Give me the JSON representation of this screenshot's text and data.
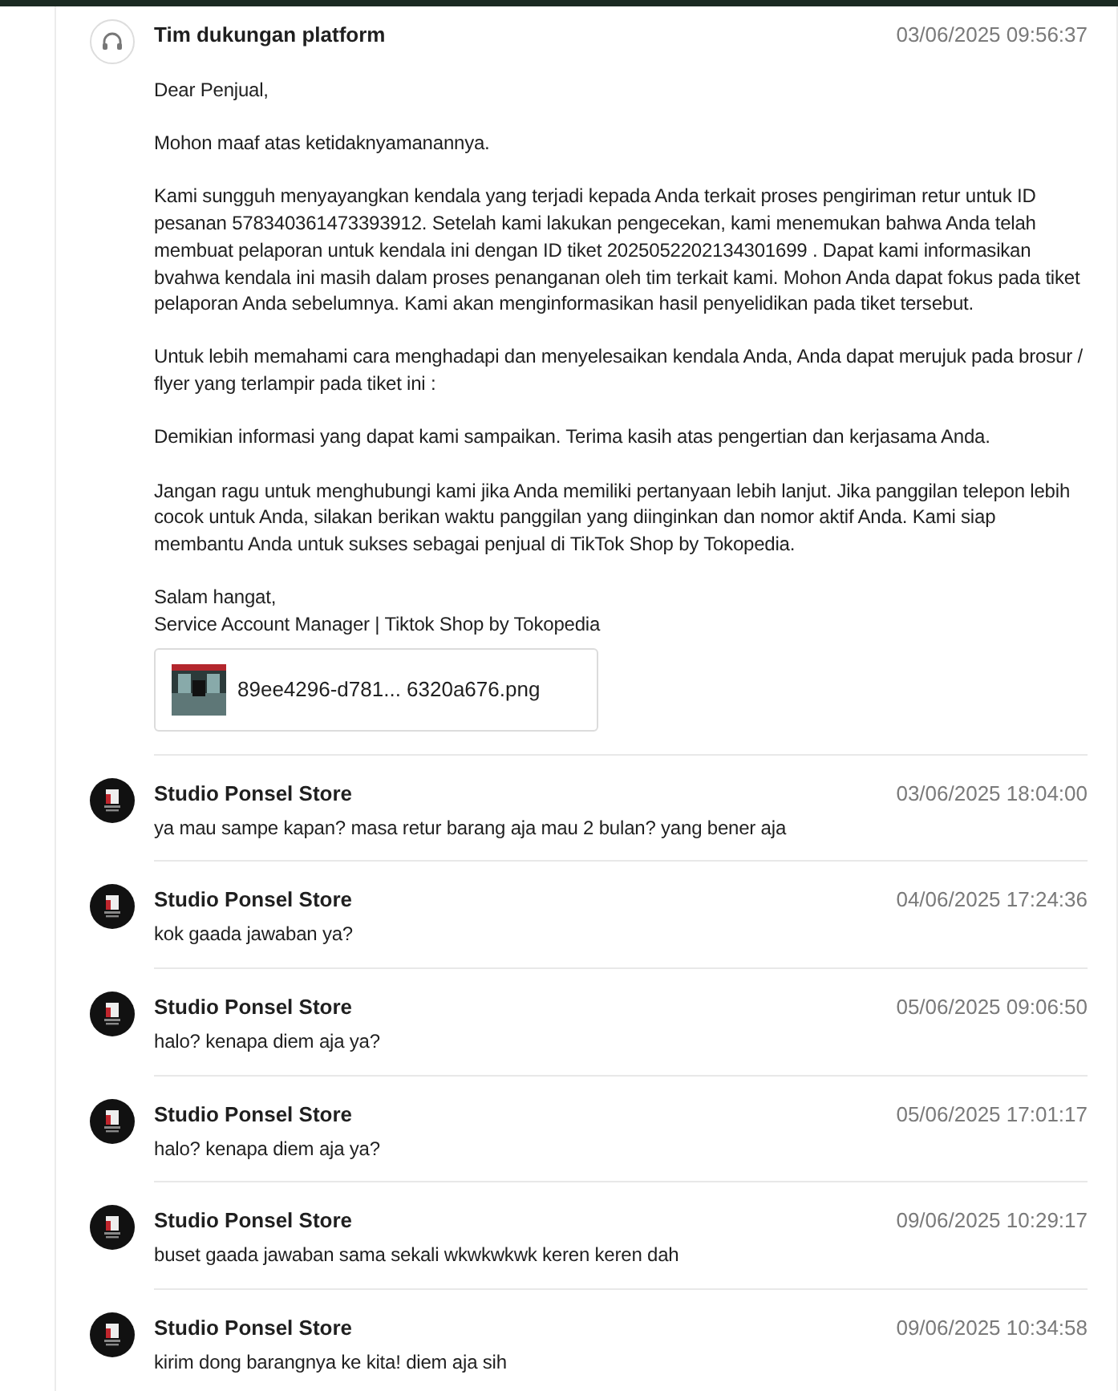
{
  "messages": [
    {
      "kind": "support",
      "sender": "Tim dukungan platform",
      "time": "03/06/2025 09:56:37",
      "paragraphs": [
        "Dear Penjual,",
        "Mohon maaf atas ketidaknyamanannya.",
        "Kami sungguh menyayangkan kendala yang terjadi kepada Anda terkait proses pengiriman retur untuk ID pesanan 578340361473393912. Setelah kami lakukan pengecekan, kami menemukan bahwa Anda telah membuat pelaporan untuk kendala ini dengan ID tiket 2025052202134301699 . Dapat kami informasikan bvahwa kendala ini masih dalam proses penanganan oleh tim terkait kami. Mohon Anda dapat fokus pada tiket pelaporan Anda sebelumnya. Kami akan menginformasikan hasil penyelidikan pada tiket tersebut.",
        "Untuk lebih memahami cara menghadapi dan menyelesaikan kendala Anda, Anda dapat merujuk pada brosur / flyer yang terlampir pada tiket ini :",
        "Demikian informasi yang dapat kami sampaikan. Terima kasih atas pengertian dan kerjasama Anda.",
        "Jangan ragu untuk menghubungi kami jika Anda memiliki pertanyaan lebih lanjut. Jika panggilan telepon lebih cocok untuk Anda, silakan berikan waktu panggilan yang diinginkan dan nomor aktif Anda. Kami siap membantu Anda untuk sukses sebagai penjual di TikTok Shop by Tokopedia.",
        "Salam hangat,\nService Account Manager | Tiktok Shop by Tokopedia"
      ],
      "attachment": {
        "name": "89ee4296-d781... 6320a676.png"
      }
    },
    {
      "kind": "seller",
      "sender": "Studio Ponsel Store",
      "time": "03/06/2025 18:04:00",
      "paragraphs": [
        "ya mau sampe kapan? masa retur barang aja mau 2 bulan? yang bener aja"
      ]
    },
    {
      "kind": "seller",
      "sender": "Studio Ponsel Store",
      "time": "04/06/2025 17:24:36",
      "paragraphs": [
        "kok gaada jawaban ya?"
      ]
    },
    {
      "kind": "seller",
      "sender": "Studio Ponsel Store",
      "time": "05/06/2025 09:06:50",
      "paragraphs": [
        "halo? kenapa diem aja ya?"
      ]
    },
    {
      "kind": "seller",
      "sender": "Studio Ponsel Store",
      "time": "05/06/2025 17:01:17",
      "paragraphs": [
        "halo? kenapa diem aja ya?"
      ]
    },
    {
      "kind": "seller",
      "sender": "Studio Ponsel Store",
      "time": "09/06/2025 10:29:17",
      "paragraphs": [
        "buset gaada jawaban sama sekali wkwkwkwk keren keren dah"
      ]
    },
    {
      "kind": "seller",
      "sender": "Studio Ponsel Store",
      "time": "09/06/2025 10:34:58",
      "paragraphs": [
        "kirim dong barangnya ke kita! diem aja sih"
      ]
    }
  ]
}
